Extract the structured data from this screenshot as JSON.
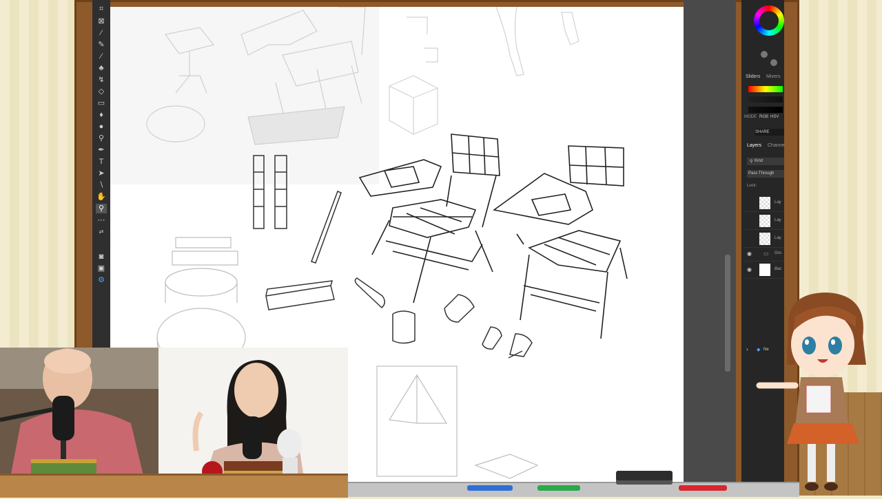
{
  "photoshop": {
    "panel": {
      "tabs": [
        "Sliders",
        "Mixers"
      ],
      "mode_label": "MODE",
      "mode_values": [
        "RGB",
        "HSV"
      ],
      "shared_label": "SHARE",
      "layers_tabs": [
        "Layers",
        "Channe"
      ],
      "kind_filter": "Kind",
      "blend_mode": "Pass Through",
      "lock_label": "Lock:",
      "layers": [
        {
          "name": "Lay",
          "visible": false
        },
        {
          "name": "Lay",
          "visible": false
        },
        {
          "name": "Lay",
          "visible": false
        },
        {
          "name": "Gro",
          "visible": true
        },
        {
          "name": "Bac",
          "visible": true
        }
      ],
      "new_item": "Ne"
    },
    "toolbar": {
      "tools": [
        "crop-icon",
        "frame-icon",
        "eyedropper-icon",
        "healing-icon",
        "brush-icon",
        "stamp-icon",
        "history-brush-icon",
        "eraser-icon",
        "gradient-icon",
        "blur-icon",
        "dodge-icon",
        "pen-icon",
        "type-icon",
        "path-select-icon",
        "shape-icon",
        "hand-icon",
        "zoom-icon",
        "more-icon",
        "swap-colors-icon",
        "colors-icon",
        "quickmask-icon",
        "screenmode-icon",
        "artboard-icon"
      ]
    }
  },
  "stream": {
    "host1_mic_brand": "",
    "host2_mic_brand": ""
  }
}
